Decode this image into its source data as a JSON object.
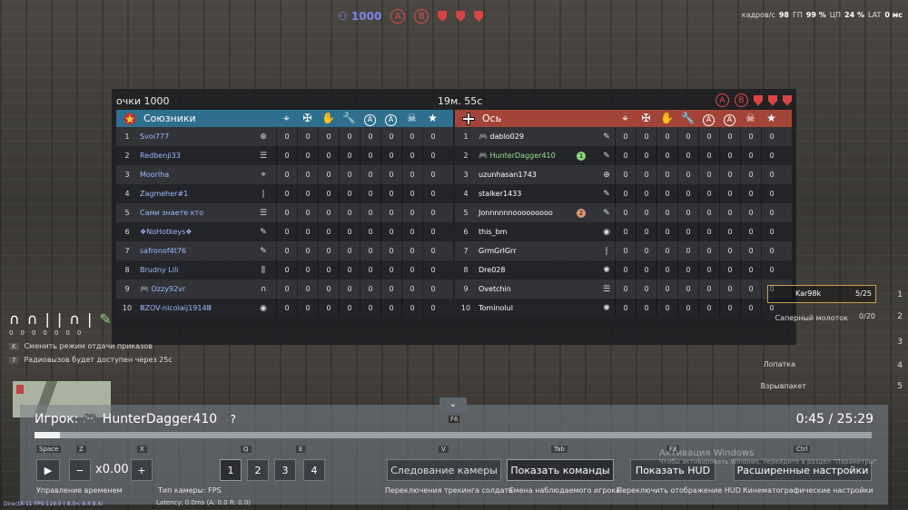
{
  "top_hud": {
    "score": "1000",
    "objectives": [
      "A",
      "B"
    ],
    "stats": {
      "fps_label": "кадров/с",
      "fps": "98",
      "gpu_label": "ГП",
      "gpu": "99 %",
      "cpu_label": "ЦП",
      "cpu": "24 %",
      "lat_label": "LAT",
      "lat": "0 мс"
    }
  },
  "board": {
    "points": "очки 1000",
    "timer": "19м. 55с",
    "objectives": [
      "A",
      "B"
    ]
  },
  "allies": {
    "name": "Союзники",
    "players": [
      {
        "num": "1",
        "name": "Svoi777",
        "role": "⊕"
      },
      {
        "num": "2",
        "name": "Redbenji33",
        "role": "☰"
      },
      {
        "num": "3",
        "name": "Moorlha",
        "role": "⌖"
      },
      {
        "num": "4",
        "name": "Zagmeher#1",
        "role": "|"
      },
      {
        "num": "5",
        "name": "Сами знаете кто",
        "role": "☰"
      },
      {
        "num": "6",
        "name": "❖NoHotkeys❖",
        "role": "✎"
      },
      {
        "num": "7",
        "name": "safronof4t76",
        "role": "✎"
      },
      {
        "num": "8",
        "name": "Brudny Lili",
        "role": "⫼"
      },
      {
        "num": "9",
        "name": "🎮 Ozzy92vr",
        "role": "∩"
      },
      {
        "num": "10",
        "name": "ⅢZOV-nicolaij1914Ⅲ",
        "role": "◉"
      }
    ]
  },
  "axis": {
    "name": "Ось",
    "players": [
      {
        "num": "1",
        "name": "🎮 dablo029",
        "role": "✎",
        "badge": ""
      },
      {
        "num": "2",
        "name": "🎮 HunterDagger410",
        "role": "✎",
        "badge": "1"
      },
      {
        "num": "3",
        "name": "uzunhasan1743",
        "role": "⊕",
        "badge": ""
      },
      {
        "num": "4",
        "name": "stalker1433",
        "role": "✎",
        "badge": ""
      },
      {
        "num": "5",
        "name": "Jonnnnnnooooooooo",
        "role": "✎",
        "badge": "2"
      },
      {
        "num": "6",
        "name": "this_bm",
        "role": "◉",
        "badge": ""
      },
      {
        "num": "7",
        "name": "GrmGrlGrr",
        "role": "|",
        "badge": ""
      },
      {
        "num": "8",
        "name": "Dre028",
        "role": "✺",
        "badge": ""
      },
      {
        "num": "9",
        "name": "Ovetchin",
        "role": "☰",
        "badge": ""
      },
      {
        "num": "10",
        "name": "Tominolul",
        "role": "✺",
        "badge": ""
      }
    ]
  },
  "stat_value": "0",
  "left_hud": {
    "counts": [
      "0",
      "0",
      "0",
      "0",
      "0",
      "0",
      "0"
    ],
    "hint_k_key": "K",
    "hint_k": "Сменить режим отдачи приказов",
    "hint_7_key": "7",
    "hint_7": "Радиовызов будет доступен через 25с"
  },
  "right_hud": {
    "weapon1": "Kar98k",
    "ammo1": "5/25",
    "slot1": "1",
    "weapon2": "Саперный молоток",
    "ammo2": "0/20",
    "slot2": "2",
    "weapon3": "Лопатка",
    "weapon4": "Взрывпакет",
    "slot3": "3",
    "slot4": "4",
    "slot5": "5"
  },
  "spectator": {
    "f6_key": "F6",
    "player_label": "Игрок:",
    "player_name": "🎮 HunterDagger410",
    "help": "?",
    "time": "0:45 / 25:29",
    "progress": 0.03,
    "keys": {
      "space": "Space",
      "z": "Z",
      "x": "X",
      "q": "Q",
      "e": "E",
      "v": "V",
      "tab": "Tab",
      "f8": "F8",
      "ctrl": "Ctrl"
    },
    "speed": "x0.00",
    "cam_buttons": [
      "1",
      "2",
      "3",
      "4"
    ],
    "follow_camera": "Следование камеры",
    "show_teams": "Показать команды",
    "show_hud": "Показать HUD",
    "advanced": "Расширенные настройки",
    "cap_time": "Управление временем",
    "cap_cam": "Тип камеры: FPS",
    "cap_follow": "Переключения трекинга солдата",
    "cap_teams": "Смена наблюдаемого игрока",
    "cap_hud": "Переключить отображение HUD",
    "cap_cine": "Кинематографические настройки",
    "latency": "Latency:  0.0ms (A:  0.0 R:  0.0)"
  },
  "watermark": {
    "title": "Активация Windows",
    "sub": "Чтобы активировать Windows, перейдите в раздел \"Параметры\""
  },
  "directx": "DirectX 11 FPS:119.0 ( 8.0< 9.4  8.4)"
}
